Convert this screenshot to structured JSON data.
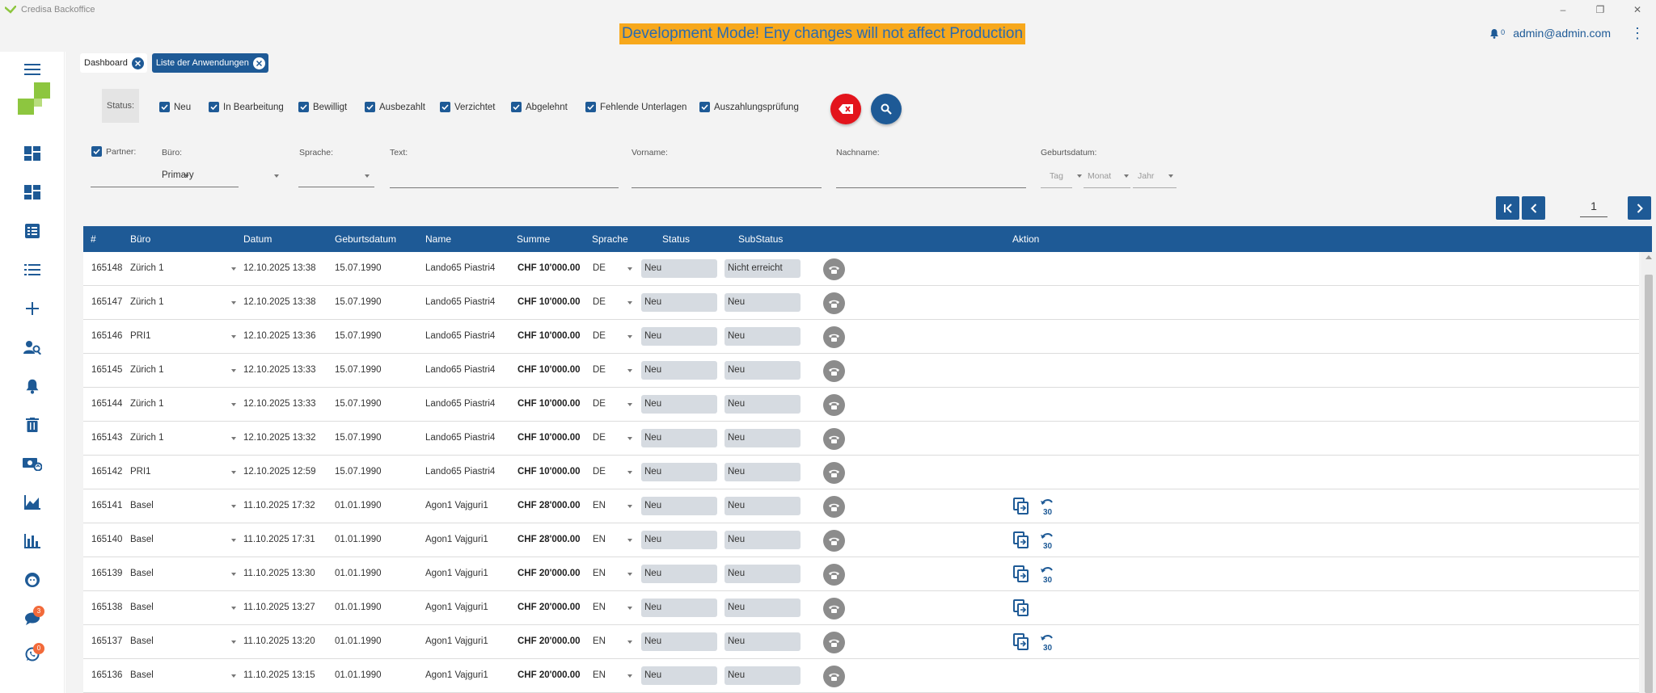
{
  "window": {
    "title": "Credisa Backoffice"
  },
  "header": {
    "dev_banner": "Development Mode! Eny changes will not affect Production",
    "notification_count": "0",
    "user": "admin@admin.com"
  },
  "sidebar": {
    "chat_badge": "3",
    "whatsapp_badge": "0"
  },
  "tabs": [
    {
      "label": "Dashboard"
    },
    {
      "label": "Liste der Anwendungen"
    }
  ],
  "filters": {
    "status_label": "Status:",
    "statuses": [
      "Neu",
      "In Bearbeitung",
      "Bewilligt",
      "Ausbezahlt",
      "Verzichtet",
      "Abgelehnt",
      "Fehlende Unterlagen",
      "Auszahlungsprüfung"
    ],
    "partner_label": "Partner:",
    "buero_label": "Büro:",
    "buero_value": "Primary",
    "sprache_label": "Sprache:",
    "text_label": "Text:",
    "vorname_label": "Vorname:",
    "nachname_label": "Nachname:",
    "geburtsdatum_label": "Geburtsdatum:",
    "tag": "Tag",
    "monat": "Monat",
    "jahr": "Jahr"
  },
  "pagination": {
    "current_page": "1"
  },
  "table": {
    "columns": [
      "#",
      "Büro",
      "Datum",
      "Geburtsdatum",
      "Name",
      "Summe",
      "Sprache",
      "Status",
      "SubStatus",
      "Aktion"
    ],
    "rows": [
      {
        "id": "165148",
        "buero": "Zürich 1",
        "datum": "12.10.2025 13:38",
        "geburtsdatum": "15.07.1990",
        "name": "Lando65 Piastri4",
        "summe": "CHF 10'000.00",
        "sprache": "DE",
        "status": "Neu",
        "substatus": "Nicht erreicht"
      },
      {
        "id": "165147",
        "buero": "Zürich 1",
        "datum": "12.10.2025 13:38",
        "geburtsdatum": "15.07.1990",
        "name": "Lando65 Piastri4",
        "summe": "CHF 10'000.00",
        "sprache": "DE",
        "status": "Neu",
        "substatus": "Neu"
      },
      {
        "id": "165146",
        "buero": "PRI1",
        "datum": "12.10.2025 13:36",
        "geburtsdatum": "15.07.1990",
        "name": "Lando65 Piastri4",
        "summe": "CHF 10'000.00",
        "sprache": "DE",
        "status": "Neu",
        "substatus": "Neu"
      },
      {
        "id": "165145",
        "buero": "Zürich 1",
        "datum": "12.10.2025 13:33",
        "geburtsdatum": "15.07.1990",
        "name": "Lando65 Piastri4",
        "summe": "CHF 10'000.00",
        "sprache": "DE",
        "status": "Neu",
        "substatus": "Neu"
      },
      {
        "id": "165144",
        "buero": "Zürich 1",
        "datum": "12.10.2025 13:33",
        "geburtsdatum": "15.07.1990",
        "name": "Lando65 Piastri4",
        "summe": "CHF 10'000.00",
        "sprache": "DE",
        "status": "Neu",
        "substatus": "Neu"
      },
      {
        "id": "165143",
        "buero": "Zürich 1",
        "datum": "12.10.2025 13:32",
        "geburtsdatum": "15.07.1990",
        "name": "Lando65 Piastri4",
        "summe": "CHF 10'000.00",
        "sprache": "DE",
        "status": "Neu",
        "substatus": "Neu"
      },
      {
        "id": "165142",
        "buero": "PRI1",
        "datum": "12.10.2025 12:59",
        "geburtsdatum": "15.07.1990",
        "name": "Lando65 Piastri4",
        "summe": "CHF 10'000.00",
        "sprache": "DE",
        "status": "Neu",
        "substatus": "Neu"
      },
      {
        "id": "165141",
        "buero": "Basel",
        "datum": "11.10.2025 17:32",
        "geburtsdatum": "01.01.1990",
        "name": "Agon1 Vajguri1",
        "summe": "CHF 28'000.00",
        "sprache": "EN",
        "status": "Neu",
        "substatus": "Neu"
      },
      {
        "id": "165140",
        "buero": "Basel",
        "datum": "11.10.2025 17:31",
        "geburtsdatum": "01.01.1990",
        "name": "Agon1 Vajguri1",
        "summe": "CHF 28'000.00",
        "sprache": "EN",
        "status": "Neu",
        "substatus": "Neu"
      },
      {
        "id": "165139",
        "buero": "Basel",
        "datum": "11.10.2025 13:30",
        "geburtsdatum": "01.01.1990",
        "name": "Agon1 Vajguri1",
        "summe": "CHF 20'000.00",
        "sprache": "EN",
        "status": "Neu",
        "substatus": "Neu"
      },
      {
        "id": "165138",
        "buero": "Basel",
        "datum": "11.10.2025 13:27",
        "geburtsdatum": "01.01.1990",
        "name": "Agon1 Vajguri1",
        "summe": "CHF 20'000.00",
        "sprache": "EN",
        "status": "Neu",
        "substatus": "Neu"
      },
      {
        "id": "165137",
        "buero": "Basel",
        "datum": "11.10.2025 13:20",
        "geburtsdatum": "01.01.1990",
        "name": "Agon1 Vajguri1",
        "summe": "CHF 20'000.00",
        "sprache": "EN",
        "status": "Neu",
        "substatus": "Neu"
      },
      {
        "id": "165136",
        "buero": "Basel",
        "datum": "11.10.2025 13:15",
        "geburtsdatum": "01.01.1990",
        "name": "Agon1 Vajguri1",
        "summe": "CHF 20'000.00",
        "sprache": "EN",
        "status": "Neu",
        "substatus": "Neu"
      }
    ]
  },
  "colors": {
    "primary": "#1e5a96",
    "banner": "#f7a81c",
    "clear_button": "#e3141c",
    "logo_green": "#8dc63f"
  }
}
